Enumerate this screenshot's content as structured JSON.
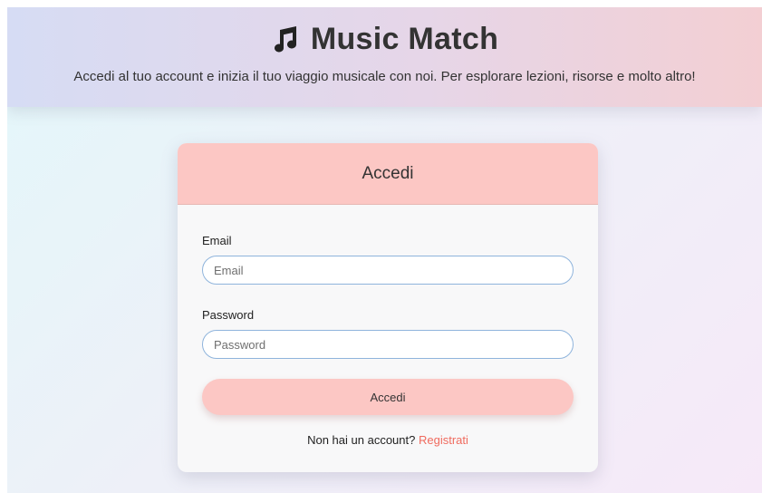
{
  "header": {
    "title": "Music Match",
    "icon": "music-note-icon",
    "subtitle": "Accedi al tuo account e inizia il tuo viaggio musicale con noi. Per esplorare lezioni, risorse e molto altro!"
  },
  "login_card": {
    "title": "Accedi",
    "email": {
      "label": "Email",
      "placeholder": "Email",
      "value": ""
    },
    "password": {
      "label": "Password",
      "placeholder": "Password",
      "value": ""
    },
    "submit_label": "Accedi",
    "signup_prompt": "Non hai un account?",
    "signup_link": "Registrati"
  },
  "colors": {
    "accent_pink": "#fcc7c4",
    "link_color": "#f06b5f",
    "input_border": "#8fb4dc",
    "text_dark": "#333333"
  }
}
